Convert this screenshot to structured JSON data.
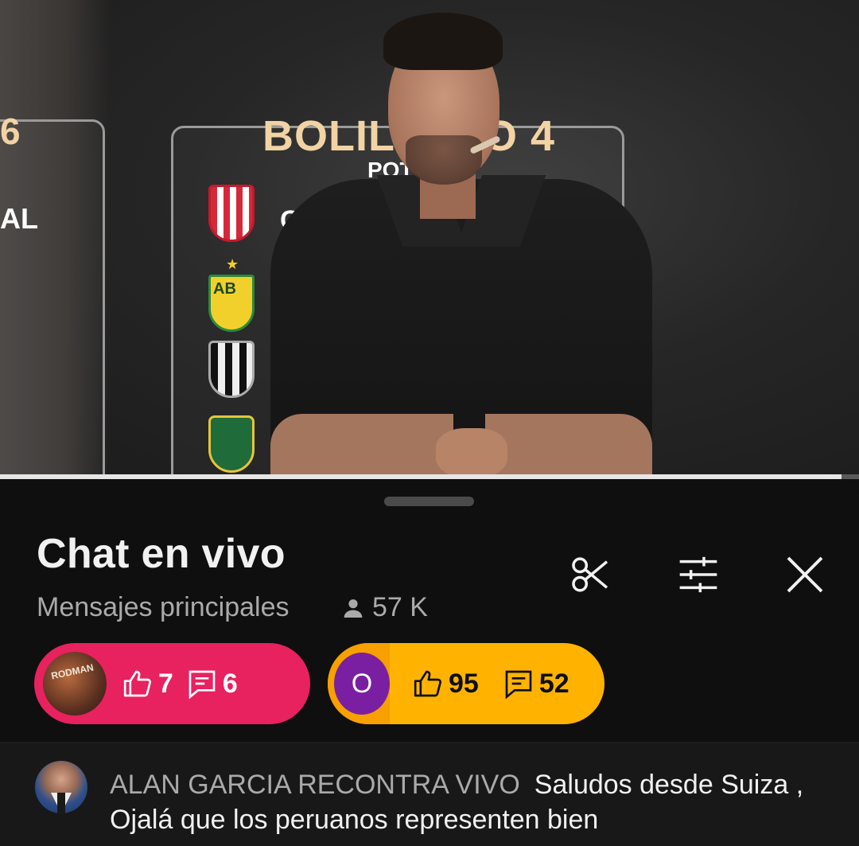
{
  "video": {
    "overlay": {
      "pot_title": "BOLILLERO 4",
      "pot_sub": "POT",
      "left_fragment": "AL",
      "left_number": "6",
      "team_fragment": "CAR"
    },
    "progress_percent": 98
  },
  "chat": {
    "title": "Chat en vivo",
    "mode_label": "Mensajes principales",
    "viewers": "57 K",
    "icons": {
      "clip": "scissors-icon",
      "settings": "filter-sliders-icon",
      "close": "close-icon"
    },
    "pinned_pills": [
      {
        "avatar_text": "RODMAN",
        "likes": "7",
        "replies": "6",
        "color": "#e8215f"
      },
      {
        "avatar_letter": "O",
        "likes": "95",
        "replies": "52",
        "color": "#ffb300",
        "avatar_color": "#7b1fa2"
      }
    ],
    "messages": [
      {
        "author": "ALAN GARCIA RECONTRA VIVO",
        "text": "Saludos desde Suiza , Ojalá que los peruanos representen bien"
      }
    ]
  }
}
